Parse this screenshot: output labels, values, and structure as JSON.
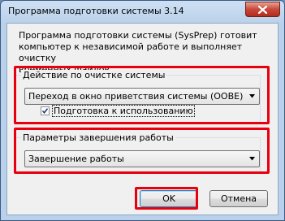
{
  "window": {
    "title": "Программа подготовки системы 3.14",
    "close_icon": "close-icon"
  },
  "description": "Программа подготовки системы (SysPrep) готовит\nкомпьютер к независимой работе и выполняет очистку\nвременных файлов.",
  "cleanup_group": {
    "legend": "Действие по очистке системы",
    "selected": "Переход в окно приветствия системы (OOBE)",
    "generalize_label": "Подготовка к использованию",
    "generalize_checked": true
  },
  "shutdown_group": {
    "legend": "Параметры завершения работы",
    "selected": "Завершение работы"
  },
  "buttons": {
    "ok": "OK",
    "cancel": "Отмена"
  },
  "colors": {
    "highlight": "#e8000d",
    "title_bar": "#b9d1ea"
  }
}
